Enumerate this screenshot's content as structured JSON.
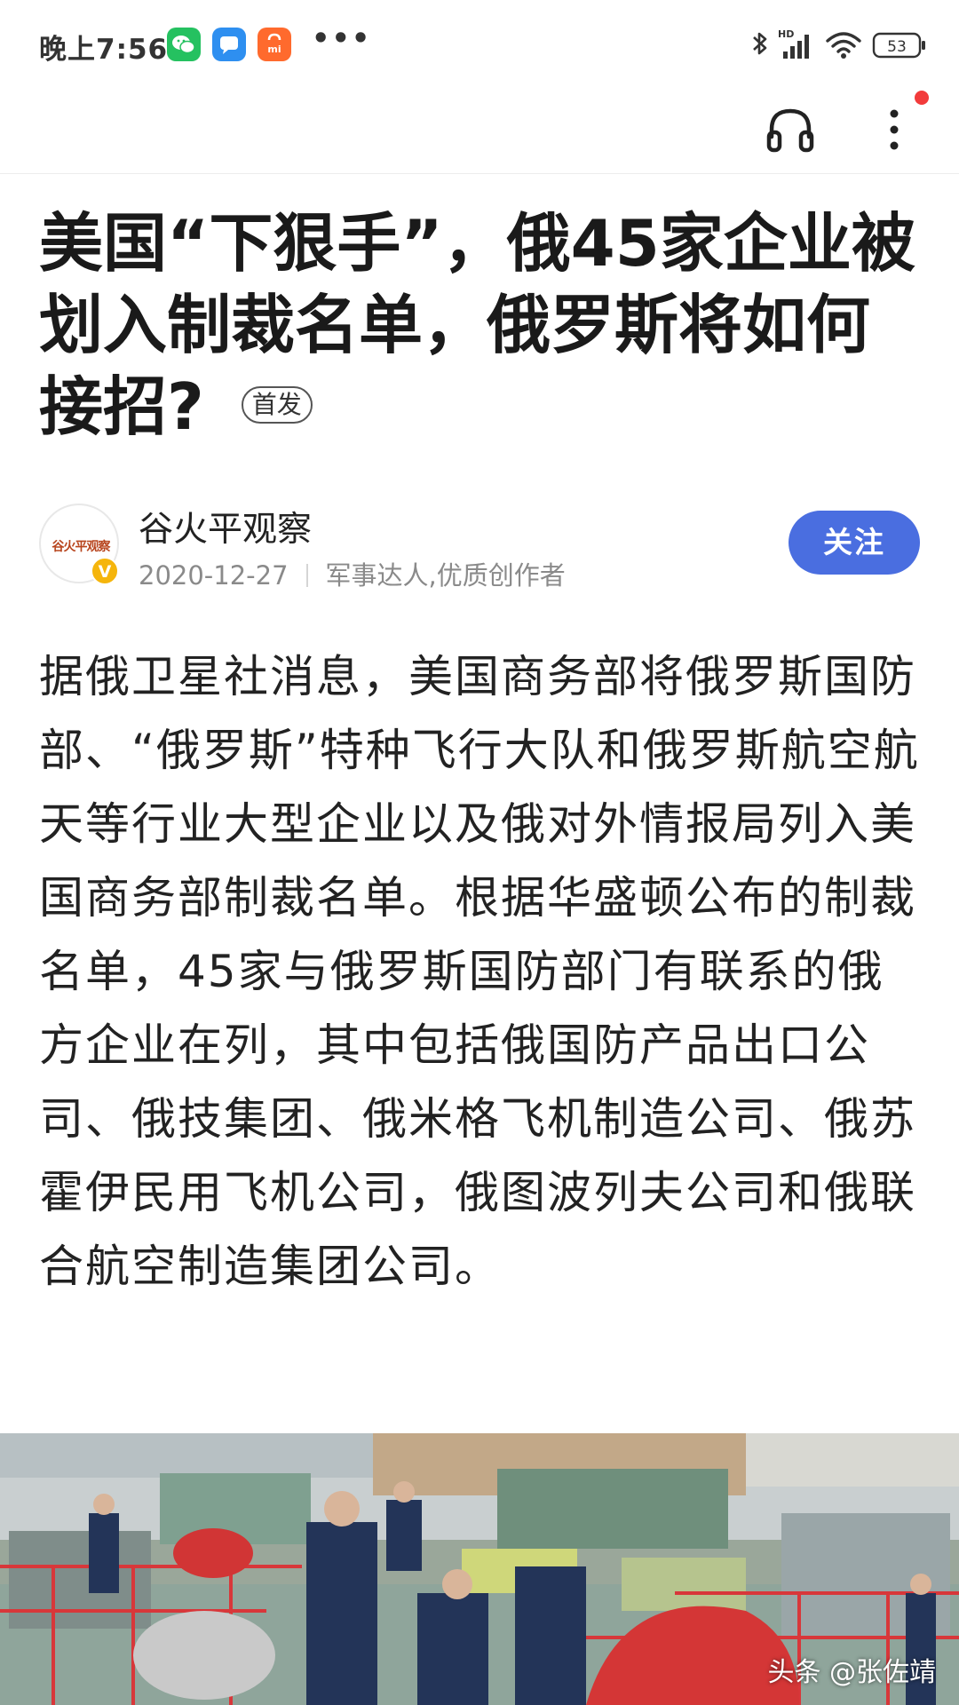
{
  "status_bar": {
    "time": "晚上7:56",
    "notification_icons": [
      "wechat-icon",
      "message-icon",
      "mi-store-icon"
    ],
    "more_indicator": "•••",
    "network": "HD",
    "battery": "53"
  },
  "action_bar": {
    "icons": [
      "headphone-icon",
      "more-vertical-icon"
    ],
    "has_notification_dot": true
  },
  "article": {
    "title": "美国“下狠手”，俄45家企业被划入制裁名单，俄罗斯将如何接招?",
    "badge": "首发",
    "author": {
      "name": "谷火平观察",
      "avatar_text": "谷火平观察",
      "verified_mark": "V",
      "date": "2020-12-27",
      "tags": "军事达人,优质创作者"
    },
    "follow_label": "关注",
    "body": "据俄卫星社消息，美国商务部将俄罗斯国防部、“俄罗斯”特种飞行大队和俄罗斯航空航天等行业大型企业以及俄对外情报局列入美国商务部制裁名单。根据华盛顿公布的制裁名单，45家与俄罗斯国防部门有联系的俄方企业在列，其中包括俄国防产品出口公司、俄技集团、俄米格飞机制造公司、俄苏霍伊民用飞机公司，俄图波列夫公司和俄联合航空制造集团公司。",
    "image_watermark": "头条 @张佐靖"
  },
  "colors": {
    "follow_button": "#4a6ee0",
    "notification_dot": "#f23b3b",
    "verified_badge": "#f5b50c",
    "wechat": "#25c160",
    "message": "#2e8ff0",
    "mi_store": "#ff6a2d"
  }
}
